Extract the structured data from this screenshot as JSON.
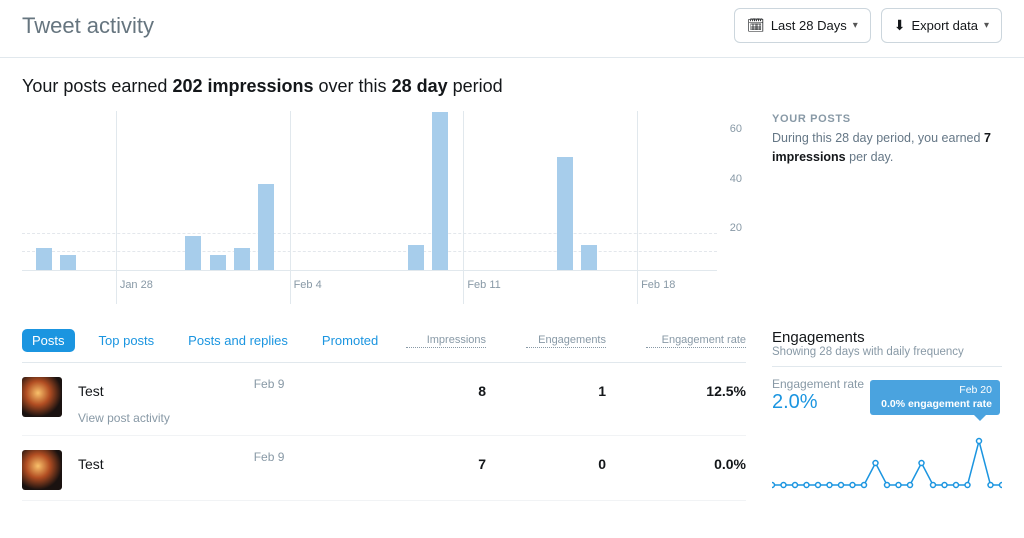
{
  "header": {
    "title": "Tweet activity",
    "date_range_label": "Last 28 Days",
    "export_label": "Export data"
  },
  "summary": {
    "prefix": "Your posts earned ",
    "impressions_bold": "202 impressions",
    "mid": " over this ",
    "period_bold": "28 day",
    "suffix": " period"
  },
  "side_posts": {
    "heading": "YOUR POSTS",
    "text_prefix": "During this 28 day period, you earned ",
    "avg_bold": "7 impressions",
    "text_suffix": " per day."
  },
  "chart_data": {
    "type": "bar",
    "ylim": [
      0,
      65
    ],
    "y_ticks": [
      20,
      40,
      60
    ],
    "x_ticks": [
      {
        "label": "Jan 28",
        "pos": 0.135
      },
      {
        "label": "Feb 4",
        "pos": 0.385
      },
      {
        "label": "Feb 11",
        "pos": 0.635
      },
      {
        "label": "Feb 18",
        "pos": 0.885
      }
    ],
    "bars": [
      {
        "x": 0.02,
        "value": 9
      },
      {
        "x": 0.055,
        "value": 6
      },
      {
        "x": 0.235,
        "value": 14
      },
      {
        "x": 0.27,
        "value": 6
      },
      {
        "x": 0.305,
        "value": 9
      },
      {
        "x": 0.34,
        "value": 35
      },
      {
        "x": 0.555,
        "value": 10
      },
      {
        "x": 0.59,
        "value": 64
      },
      {
        "x": 0.77,
        "value": 46
      },
      {
        "x": 0.805,
        "value": 10
      }
    ]
  },
  "tabs": [
    {
      "label": "Posts",
      "active": true
    },
    {
      "label": "Top posts",
      "active": false
    },
    {
      "label": "Posts and replies",
      "active": false
    },
    {
      "label": "Promoted",
      "active": false
    }
  ],
  "columns": {
    "impressions": "Impressions",
    "engagements": "Engagements",
    "rate": "Engagement rate"
  },
  "posts": [
    {
      "title": "Test",
      "date": "Feb 9",
      "impressions": "8",
      "engagements": "1",
      "rate": "12.5%",
      "view_activity": "View post activity"
    },
    {
      "title": "Test",
      "date": "Feb 9",
      "impressions": "7",
      "engagements": "0",
      "rate": "0.0%"
    }
  ],
  "engagements": {
    "title": "Engagements",
    "subtitle": "Showing 28 days with daily frequency",
    "rate_label": "Engagement rate",
    "rate_value": "2.0%",
    "tooltip_date": "Feb 20",
    "tooltip_text": "0.0% engagement rate",
    "sparkline": [
      0,
      0,
      0,
      0,
      0,
      0,
      0,
      0,
      0,
      1,
      0,
      0,
      0,
      1,
      0,
      0,
      0,
      0,
      2,
      0,
      0
    ]
  }
}
